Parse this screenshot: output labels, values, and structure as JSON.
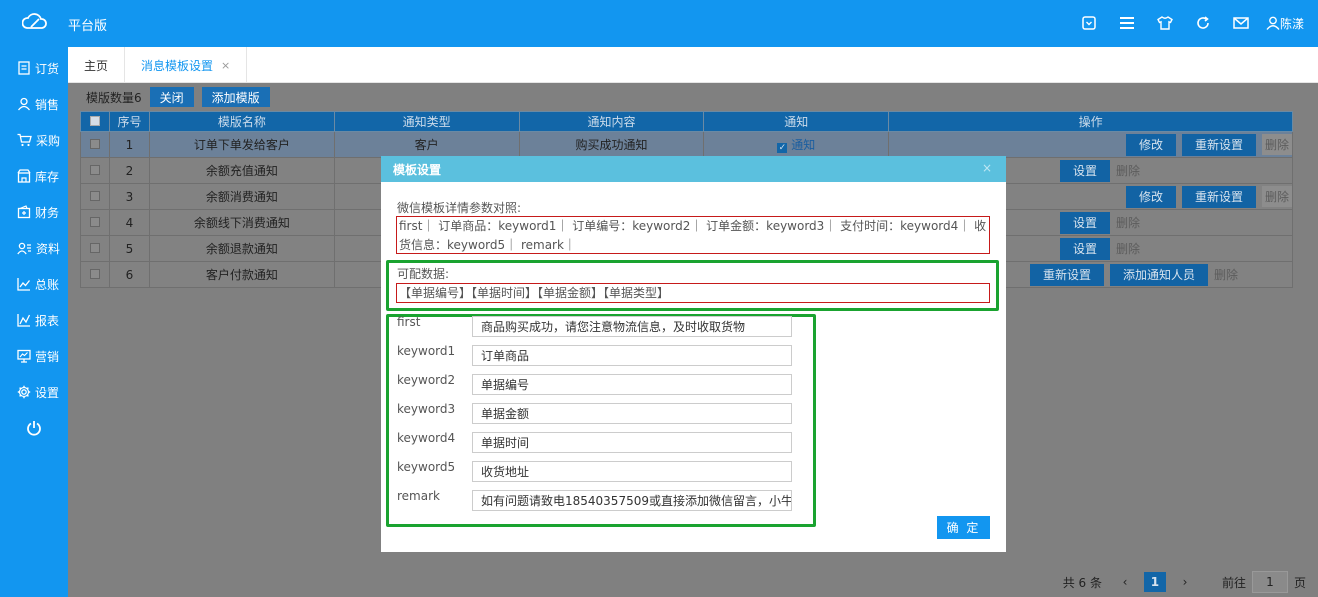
{
  "app": {
    "title": "平台版",
    "user": "陈漾"
  },
  "sidebar": {
    "items": [
      {
        "label": "订货",
        "icon": "order-icon"
      },
      {
        "label": "销售",
        "icon": "user-icon"
      },
      {
        "label": "采购",
        "icon": "cart-icon"
      },
      {
        "label": "库存",
        "icon": "store-icon"
      },
      {
        "label": "财务",
        "icon": "wallet-icon"
      },
      {
        "label": "资料",
        "icon": "contacts-icon"
      },
      {
        "label": "总账",
        "icon": "chart-icon"
      },
      {
        "label": "报表",
        "icon": "report-icon"
      },
      {
        "label": "营销",
        "icon": "monitor-icon"
      },
      {
        "label": "设置",
        "icon": "gear-icon"
      }
    ]
  },
  "tabs": [
    {
      "label": "主页"
    },
    {
      "label": "消息模板设置",
      "close": "×"
    }
  ],
  "toolbar": {
    "count_label": "模版数量6",
    "close_label": "关闭",
    "add_label": "添加模版"
  },
  "table": {
    "headers": [
      "序号",
      "模版名称",
      "通知类型",
      "通知内容",
      "通知",
      "操作"
    ],
    "rows": [
      {
        "no": "1",
        "name": "订单下单发给客户",
        "type": "客户",
        "content": "购买成功通知",
        "notice": "通知",
        "ops": [
          "修改",
          "重新设置"
        ],
        "del": "删除"
      },
      {
        "no": "2",
        "name": "余额充值通知",
        "type": "",
        "content": "",
        "notice": "",
        "ops": [
          "设置"
        ],
        "del": "删除"
      },
      {
        "no": "3",
        "name": "余额消费通知",
        "type": "",
        "content": "",
        "notice": "",
        "ops": [
          "修改",
          "重新设置"
        ],
        "del": "删除"
      },
      {
        "no": "4",
        "name": "余额线下消费通知",
        "type": "",
        "content": "",
        "notice": "",
        "ops": [
          "设置"
        ],
        "del": "删除"
      },
      {
        "no": "5",
        "name": "余额退款通知",
        "type": "",
        "content": "",
        "notice": "",
        "ops": [
          "设置"
        ],
        "del": "删除"
      },
      {
        "no": "6",
        "name": "客户付款通知",
        "type": "",
        "content": "",
        "notice": "",
        "ops": [
          "重新设置",
          "添加通知人员"
        ],
        "del": "删除"
      }
    ]
  },
  "pager": {
    "total": "共 6 条",
    "current": "1",
    "goto_prefix": "前往",
    "goto_value": "1",
    "goto_suffix": "页"
  },
  "modal": {
    "title": "模板设置",
    "close": "×",
    "params_label": "微信模板详情参数对照:",
    "params_text": "first｜ 订单商品：keyword1｜ 订单编号：keyword2｜ 订单金额：keyword3｜ 支付时间：keyword4｜ 收货信息：keyword5｜ remark｜",
    "available_label": "可配数据:",
    "available_text": "【单据编号】【单据时间】【单据金额】【单据类型】",
    "fields": [
      {
        "label": "first",
        "value": "商品购买成功，请您注意物流信息，及时收取货物"
      },
      {
        "label": "keyword1",
        "value": "订单商品"
      },
      {
        "label": "keyword2",
        "value": "单据编号"
      },
      {
        "label": "keyword3",
        "value": "单据金额"
      },
      {
        "label": "keyword4",
        "value": "单据时间"
      },
      {
        "label": "keyword5",
        "value": "收货地址"
      },
      {
        "label": "remark",
        "value": "如有问题请致电18540357509或直接添加微信留言，小牛"
      }
    ],
    "confirm_label": "确 定"
  }
}
